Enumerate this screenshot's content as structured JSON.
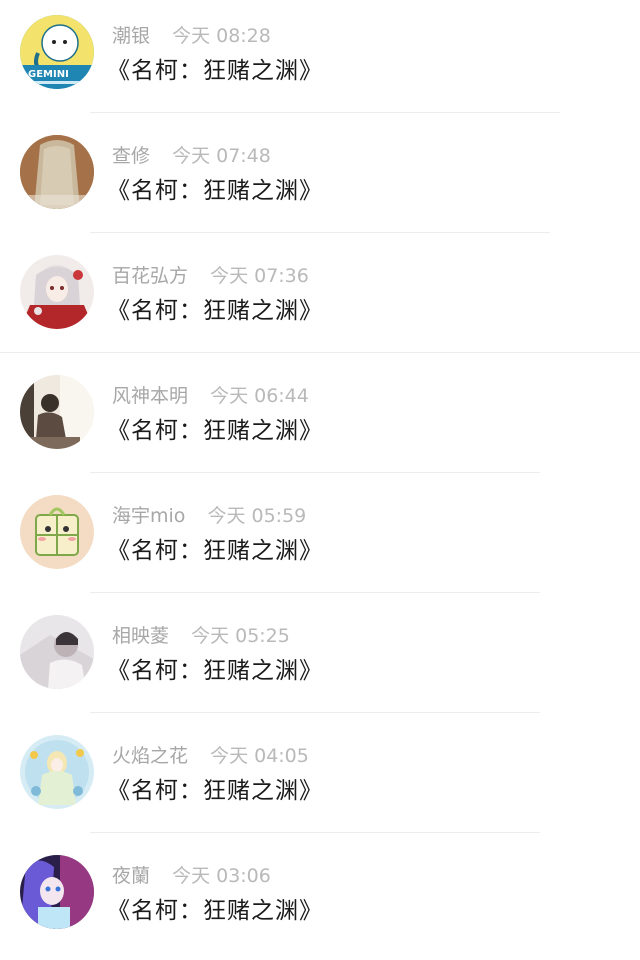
{
  "messages": [
    {
      "name": "潮银",
      "time": "今天 08:28",
      "text": "《名柯：狂赌之渊》",
      "avatar": "gemini-cartoon"
    },
    {
      "name": "查修",
      "time": "今天 07:48",
      "text": "《名柯：狂赌之渊》",
      "avatar": "long-hair-girl-back"
    },
    {
      "name": "百花弘方",
      "time": "今天 07:36",
      "text": "《名柯：狂赌之渊》",
      "avatar": "anime-girl-red"
    },
    {
      "name": "风神本明",
      "time": "今天 06:44",
      "text": "《名柯：狂赌之渊》",
      "avatar": "person-sitting-window"
    },
    {
      "name": "海宇mio",
      "time": "今天 05:59",
      "text": "《名柯：狂赌之渊》",
      "avatar": "green-cartoon"
    },
    {
      "name": "相映菱",
      "time": "今天 05:25",
      "text": "《名柯：狂赌之渊》",
      "avatar": "grey-portrait"
    },
    {
      "name": "火焰之花",
      "time": "今天 04:05",
      "text": "《名柯：狂赌之渊》",
      "avatar": "anime-fairy-blue"
    },
    {
      "name": "夜蘭",
      "time": "今天 03:06",
      "text": "《名柯：狂赌之渊》",
      "avatar": "anime-girl-purple"
    }
  ],
  "avatar_overlay_text": "GEMINI",
  "colors": {
    "name": "#a7a7a7",
    "time": "#b9b9b9",
    "message": "#1b1b1b",
    "divider": "#ededed"
  }
}
